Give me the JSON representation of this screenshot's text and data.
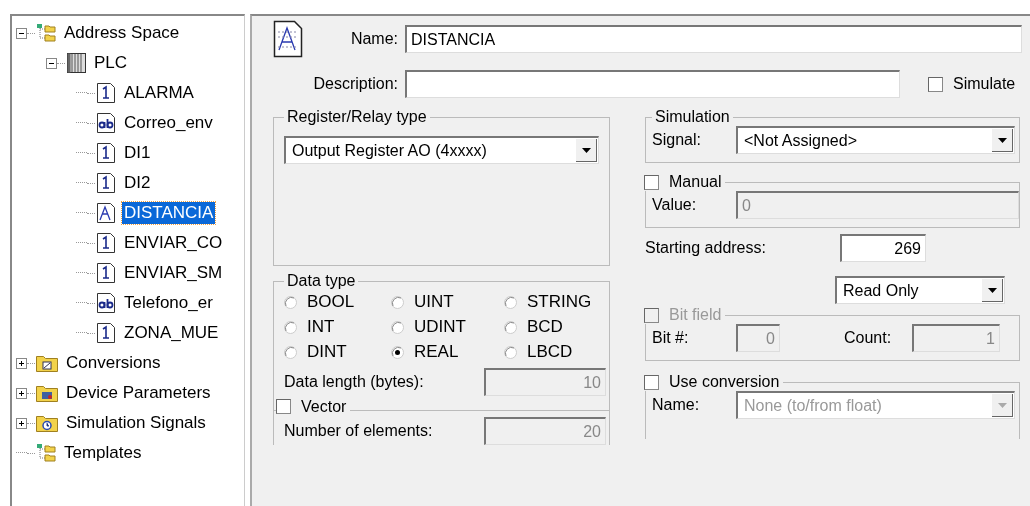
{
  "tree": [
    {
      "label": "Address Space",
      "kind": "templates",
      "expanded": true,
      "selected": false,
      "children": [
        {
          "label": "PLC",
          "kind": "device",
          "expanded": true,
          "selected": false,
          "children": [
            {
              "label": "ALARMA",
              "kind": "bit",
              "selected": false
            },
            {
              "label": "Correo_env",
              "kind": "text",
              "selected": false
            },
            {
              "label": "DI1",
              "kind": "bit",
              "selected": false
            },
            {
              "label": "DI2",
              "kind": "bit",
              "selected": false
            },
            {
              "label": "DISTANCIA",
              "kind": "analog",
              "selected": true
            },
            {
              "label": "ENVIAR_CO",
              "kind": "bit",
              "selected": false
            },
            {
              "label": "ENVIAR_SM",
              "kind": "bit",
              "selected": false
            },
            {
              "label": "Telefono_er",
              "kind": "text",
              "selected": false
            },
            {
              "label": "ZONA_MUE",
              "kind": "bit",
              "selected": false
            }
          ]
        }
      ]
    },
    {
      "label": "Conversions",
      "kind": "conversions",
      "expanded": false,
      "selected": false
    },
    {
      "label": "Device Parameters",
      "kind": "parameters",
      "expanded": false,
      "selected": false
    },
    {
      "label": "Simulation Signals",
      "kind": "signals",
      "expanded": false,
      "selected": false
    },
    {
      "label": "Templates",
      "kind": "templates",
      "selected": false
    }
  ],
  "name": {
    "label": "Name:",
    "value": "DISTANCIA"
  },
  "description": {
    "label": "Description:"
  },
  "simulate": {
    "label": "Simulate",
    "checked": false
  },
  "register": {
    "title": "Register/Relay type",
    "value": "Output Register AO (4xxxx)"
  },
  "data_type": {
    "title": "Data type",
    "options": [
      {
        "label": "BOOL",
        "selected": false
      },
      {
        "label": "UINT",
        "selected": false
      },
      {
        "label": "STRING",
        "selected": false
      },
      {
        "label": "INT",
        "selected": false
      },
      {
        "label": "UDINT",
        "selected": false
      },
      {
        "label": "BCD",
        "selected": false
      },
      {
        "label": "DINT",
        "selected": false
      },
      {
        "label": "REAL",
        "selected": true
      },
      {
        "label": "LBCD",
        "selected": false
      }
    ],
    "length_label": "Data length (bytes):",
    "length_value": "10",
    "length_disabled": true
  },
  "vector": {
    "label": "Vector",
    "checked": false,
    "count_label": "Number of elements:",
    "count_value": "20",
    "disabled": true
  },
  "simulation": {
    "title": "Simulation",
    "signal_label": "Signal:",
    "signal_value": "<Not Assigned>"
  },
  "manual": {
    "label": "Manual",
    "checked": false,
    "value_label": "Value:",
    "value": "0",
    "disabled": true
  },
  "starting_address": {
    "label": "Starting address:",
    "value": "269"
  },
  "access": {
    "value": "Read Only"
  },
  "bit_field": {
    "label": "Bit field",
    "checked": false,
    "disabled": true,
    "bit_label": "Bit #:",
    "bit_value": "0",
    "count_label": "Count:",
    "count_value": "1"
  },
  "conversion": {
    "label": "Use conversion",
    "checked": false,
    "name_label": "Name:",
    "name_value": "None (to/from float)",
    "disabled": true
  }
}
